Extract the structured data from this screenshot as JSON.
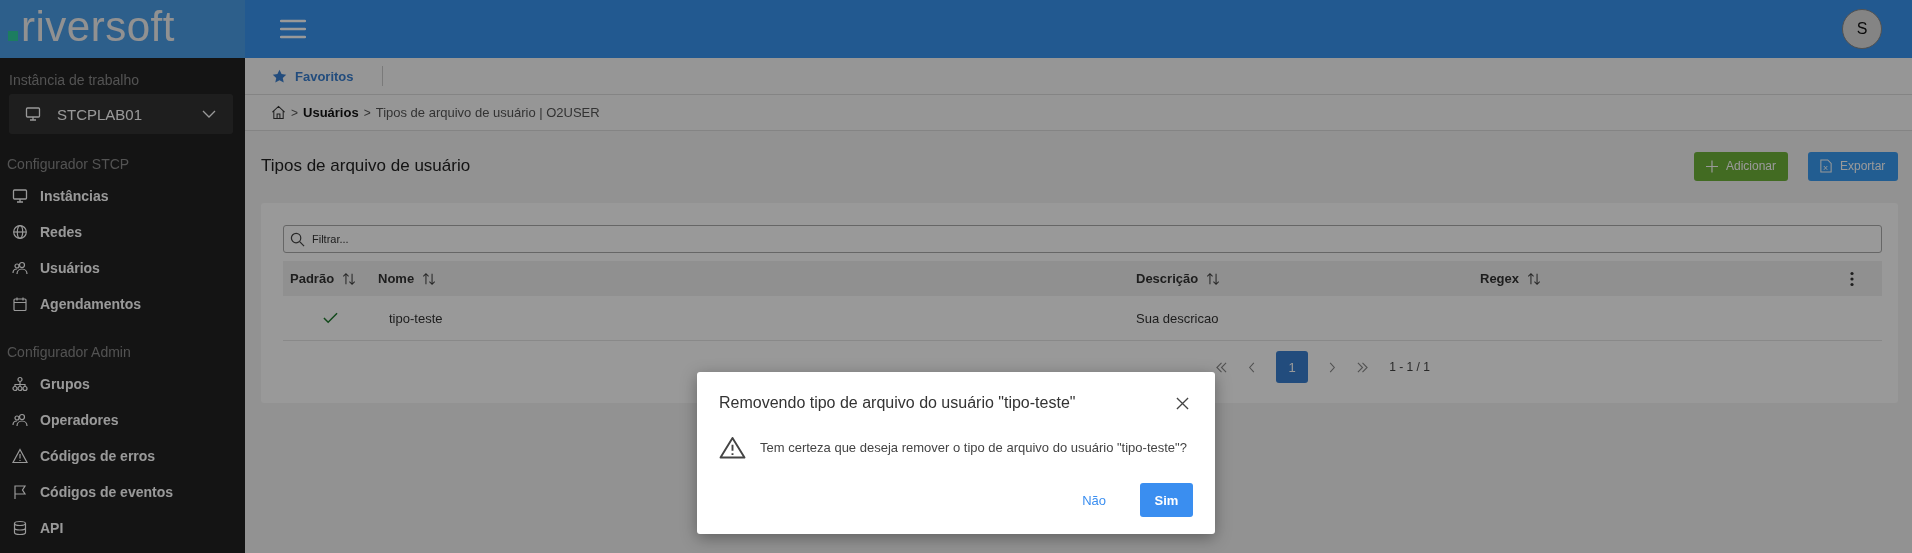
{
  "brand": {
    "name": "riversoft"
  },
  "header": {
    "avatar": "S"
  },
  "sidebar": {
    "instance_label": "Instância de trabalho",
    "instance": "STCPLAB01",
    "sections": [
      {
        "title": "Configurador STCP",
        "items": [
          {
            "label": "Instâncias"
          },
          {
            "label": "Redes"
          },
          {
            "label": "Usuários"
          },
          {
            "label": "Agendamentos"
          }
        ]
      },
      {
        "title": "Configurador Admin",
        "items": [
          {
            "label": "Grupos"
          },
          {
            "label": "Operadores"
          },
          {
            "label": "Códigos de erros"
          },
          {
            "label": "Códigos de eventos"
          },
          {
            "label": "API"
          }
        ]
      }
    ]
  },
  "favorites": {
    "label": "Favoritos"
  },
  "breadcrumb": [
    {
      "kind": "home"
    },
    {
      "kind": "separator",
      "label": ">"
    },
    {
      "kind": "link",
      "label": "Usuários"
    },
    {
      "kind": "separator",
      "label": ">"
    },
    {
      "kind": "current",
      "label": "Tipos de arquivo de usuário | O2USER"
    }
  ],
  "page_title": "Tipos de arquivo de usuário",
  "actions": [
    {
      "kind": "add",
      "label": "Adicionar"
    },
    {
      "kind": "export",
      "label": "Exportar"
    }
  ],
  "table": {
    "filter": {
      "placeholder": "Filtrar..."
    },
    "columns": [
      {
        "label": "Padrão"
      },
      {
        "label": "Nome"
      },
      {
        "label": "Descrição"
      },
      {
        "label": "Regex"
      }
    ],
    "rows": [
      {
        "default": true,
        "name": "tipo-teste",
        "description": "Sua descricao"
      }
    ],
    "pagination": {
      "pages": [
        {
          "label": "1",
          "selected": true
        }
      ],
      "range": "1 - 1 / 1"
    }
  },
  "dialog": {
    "title": "Removendo tipo de arquivo do usuário \"tipo-teste\"",
    "message": "Tem certeza que deseja remover o tipo de arquivo do usuário \"tipo-teste\"?",
    "buttons": [
      {
        "kind": "text",
        "label": "Não"
      },
      {
        "kind": "primary",
        "label": "Sim"
      }
    ]
  }
}
